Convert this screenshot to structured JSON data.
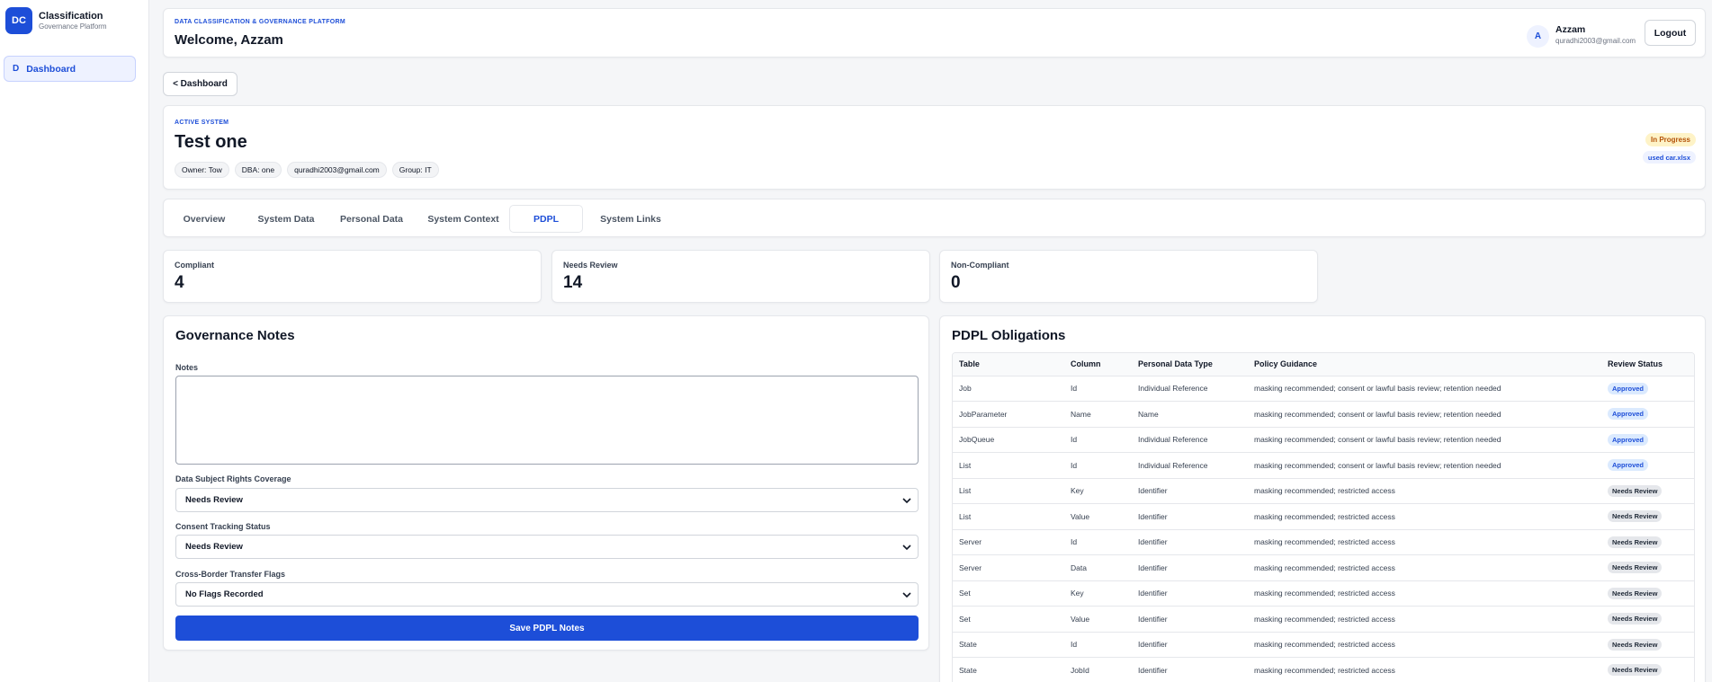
{
  "brand": {
    "logo": "DC",
    "title": "Classification",
    "subtitle": "Governance Platform"
  },
  "sidebar": {
    "items": [
      {
        "icon_letter": "D",
        "label": "Dashboard",
        "active": true
      }
    ]
  },
  "header": {
    "eyebrow": "DATA CLASSIFICATION & GOVERNANCE PLATFORM",
    "welcome": "Welcome, Azzam",
    "user": {
      "avatar": "A",
      "name": "Azzam",
      "email": "quradhi2003@gmail.com"
    },
    "logout_label": "Logout"
  },
  "back_label": "< Dashboard",
  "system": {
    "eyebrow": "ACTIVE SYSTEM",
    "title": "Test one",
    "chips": [
      "Owner: Tow",
      "DBA: one",
      "quradhi2003@gmail.com",
      "Group: IT"
    ],
    "status_badge": "In Progress",
    "file_badge": "used car.xlsx"
  },
  "tabs": [
    {
      "label": "Overview",
      "active": false
    },
    {
      "label": "System Data",
      "active": false
    },
    {
      "label": "Personal Data",
      "active": false
    },
    {
      "label": "System Context",
      "active": false
    },
    {
      "label": "PDPL",
      "active": true
    },
    {
      "label": "System Links",
      "active": false
    }
  ],
  "stats": [
    {
      "label": "Compliant",
      "value": "4"
    },
    {
      "label": "Needs Review",
      "value": "14"
    },
    {
      "label": "Non-Compliant",
      "value": "0"
    }
  ],
  "notes": {
    "title": "Governance Notes",
    "notes_label": "Notes",
    "notes_value": "",
    "rights_label": "Data Subject Rights Coverage",
    "rights_value": "Needs Review",
    "consent_label": "Consent Tracking Status",
    "consent_value": "Needs Review",
    "transfer_label": "Cross-Border Transfer Flags",
    "transfer_value": "No Flags Recorded",
    "save_label": "Save PDPL Notes"
  },
  "obligations": {
    "title": "PDPL Obligations",
    "columns": [
      "Table",
      "Column",
      "Personal Data Type",
      "Policy Guidance",
      "Review Status"
    ],
    "rows": [
      [
        "Job",
        "Id",
        "Individual Reference",
        "masking recommended; consent or lawful basis review; retention needed",
        "Approved"
      ],
      [
        "JobParameter",
        "Name",
        "Name",
        "masking recommended; consent or lawful basis review; retention needed",
        "Approved"
      ],
      [
        "JobQueue",
        "Id",
        "Individual Reference",
        "masking recommended; consent or lawful basis review; retention needed",
        "Approved"
      ],
      [
        "List",
        "Id",
        "Individual Reference",
        "masking recommended; consent or lawful basis review; retention needed",
        "Approved"
      ],
      [
        "List",
        "Key",
        "Identifier",
        "masking recommended; restricted access",
        "Needs Review"
      ],
      [
        "List",
        "Value",
        "Identifier",
        "masking recommended; restricted access",
        "Needs Review"
      ],
      [
        "Server",
        "Id",
        "Identifier",
        "masking recommended; restricted access",
        "Needs Review"
      ],
      [
        "Server",
        "Data",
        "Identifier",
        "masking recommended; restricted access",
        "Needs Review"
      ],
      [
        "Set",
        "Key",
        "Identifier",
        "masking recommended; restricted access",
        "Needs Review"
      ],
      [
        "Set",
        "Value",
        "Identifier",
        "masking recommended; restricted access",
        "Needs Review"
      ],
      [
        "State",
        "Id",
        "Identifier",
        "masking recommended; restricted access",
        "Needs Review"
      ],
      [
        "State",
        "JobId",
        "Identifier",
        "masking recommended; restricted access",
        "Needs Review"
      ]
    ]
  },
  "colors": {
    "accent": "#1d4ed8",
    "warning_bg": "#fef3c7",
    "warning_text": "#b45309"
  }
}
